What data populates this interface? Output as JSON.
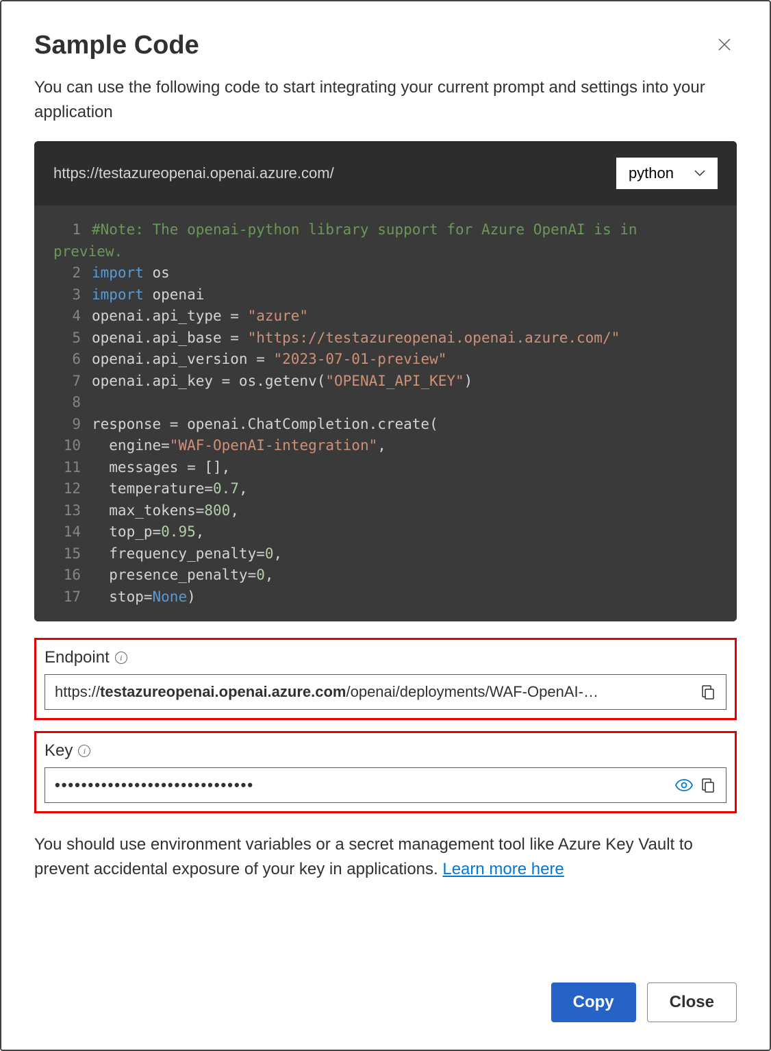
{
  "dialog": {
    "title": "Sample Code",
    "description": "You can use the following code to start integrating your current prompt and settings into your application",
    "close_label": "Close"
  },
  "code": {
    "endpoint_url": "https://testazureopenai.openai.azure.com/",
    "language": "python",
    "lines": [
      {
        "n": 1,
        "segments": [
          {
            "t": "#Note: The openai-python library support for Azure OpenAI is in",
            "c": "comment"
          }
        ]
      },
      {
        "n": null,
        "segments": [
          {
            "t": "preview.",
            "c": "comment"
          }
        ],
        "no_indent": true
      },
      {
        "n": 2,
        "segments": [
          {
            "t": "import",
            "c": "keyword"
          },
          {
            "t": " os",
            "c": "default"
          }
        ]
      },
      {
        "n": 3,
        "segments": [
          {
            "t": "import",
            "c": "keyword"
          },
          {
            "t": " openai",
            "c": "default"
          }
        ]
      },
      {
        "n": 4,
        "segments": [
          {
            "t": "openai.api_type = ",
            "c": "default"
          },
          {
            "t": "\"azure\"",
            "c": "string"
          }
        ]
      },
      {
        "n": 5,
        "segments": [
          {
            "t": "openai.api_base = ",
            "c": "default"
          },
          {
            "t": "\"https://testazureopenai.openai.azure.com/\"",
            "c": "string"
          }
        ]
      },
      {
        "n": 6,
        "segments": [
          {
            "t": "openai.api_version = ",
            "c": "default"
          },
          {
            "t": "\"2023-07-01-preview\"",
            "c": "string"
          }
        ]
      },
      {
        "n": 7,
        "segments": [
          {
            "t": "openai.api_key = os.getenv(",
            "c": "default"
          },
          {
            "t": "\"OPENAI_API_KEY\"",
            "c": "string"
          },
          {
            "t": ")",
            "c": "default"
          }
        ]
      },
      {
        "n": 8,
        "segments": []
      },
      {
        "n": 9,
        "segments": [
          {
            "t": "response = openai.ChatCompletion.create(",
            "c": "default"
          }
        ]
      },
      {
        "n": 10,
        "segments": [
          {
            "t": "  engine=",
            "c": "default"
          },
          {
            "t": "\"WAF-OpenAI-integration\"",
            "c": "string"
          },
          {
            "t": ",",
            "c": "default"
          }
        ]
      },
      {
        "n": 11,
        "segments": [
          {
            "t": "  messages = [],",
            "c": "default"
          }
        ]
      },
      {
        "n": 12,
        "segments": [
          {
            "t": "  temperature=",
            "c": "default"
          },
          {
            "t": "0.7",
            "c": "number"
          },
          {
            "t": ",",
            "c": "default"
          }
        ]
      },
      {
        "n": 13,
        "segments": [
          {
            "t": "  max_tokens=",
            "c": "default"
          },
          {
            "t": "800",
            "c": "number"
          },
          {
            "t": ",",
            "c": "default"
          }
        ]
      },
      {
        "n": 14,
        "segments": [
          {
            "t": "  top_p=",
            "c": "default"
          },
          {
            "t": "0.95",
            "c": "number"
          },
          {
            "t": ",",
            "c": "default"
          }
        ]
      },
      {
        "n": 15,
        "segments": [
          {
            "t": "  frequency_penalty=",
            "c": "default"
          },
          {
            "t": "0",
            "c": "number"
          },
          {
            "t": ",",
            "c": "default"
          }
        ]
      },
      {
        "n": 16,
        "segments": [
          {
            "t": "  presence_penalty=",
            "c": "default"
          },
          {
            "t": "0",
            "c": "number"
          },
          {
            "t": ",",
            "c": "default"
          }
        ]
      },
      {
        "n": 17,
        "segments": [
          {
            "t": "  stop=",
            "c": "default"
          },
          {
            "t": "None",
            "c": "none"
          },
          {
            "t": ")",
            "c": "default"
          }
        ]
      }
    ]
  },
  "endpoint": {
    "label": "Endpoint",
    "prefix": "https://",
    "bold": "testazureopenai.openai.azure.com",
    "suffix": "/openai/deployments/WAF-OpenAI-…"
  },
  "key": {
    "label": "Key",
    "masked_value": "••••••••••••••••••••••••••••••"
  },
  "disclaimer": {
    "text": "You should use environment variables or a secret management tool like Azure Key Vault to prevent accidental exposure of your key in applications. ",
    "link_text": "Learn more here"
  },
  "buttons": {
    "copy": "Copy",
    "close": "Close"
  }
}
